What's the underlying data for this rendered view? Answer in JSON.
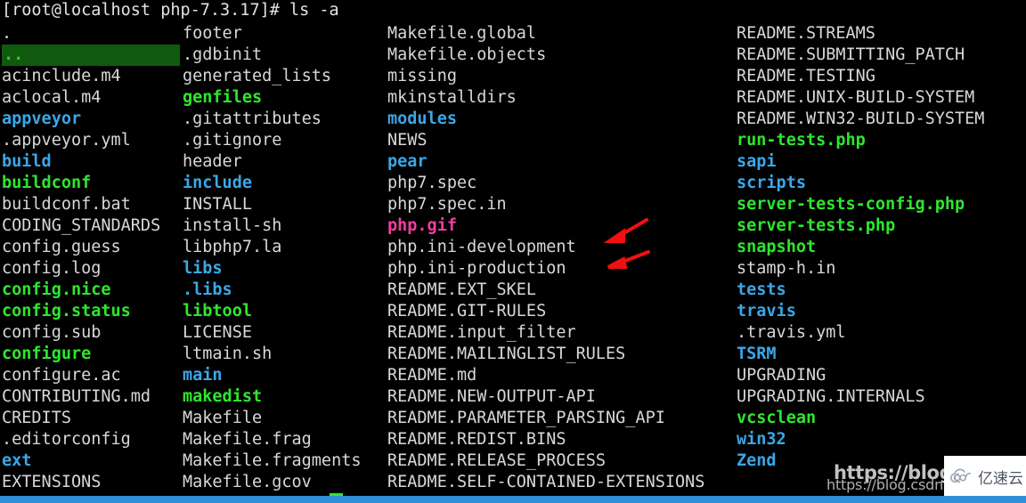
{
  "terminal": {
    "prompt": "[root@localhost php-7.3.17]# ls -a",
    "columns": [
      {
        "name": "column-1",
        "entries": [
          {
            "label": ".",
            "style": "c-white"
          },
          {
            "label": "..",
            "style": "c-selgreen"
          },
          {
            "label": "acinclude.m4",
            "style": "c-white"
          },
          {
            "label": "aclocal.m4",
            "style": "c-white"
          },
          {
            "label": "appveyor",
            "style": "c-blue"
          },
          {
            "label": ".appveyor.yml",
            "style": "c-white"
          },
          {
            "label": "build",
            "style": "c-blue"
          },
          {
            "label": "buildconf",
            "style": "c-green"
          },
          {
            "label": "buildconf.bat",
            "style": "c-white"
          },
          {
            "label": "CODING_STANDARDS",
            "style": "c-white"
          },
          {
            "label": "config.guess",
            "style": "c-white"
          },
          {
            "label": "config.log",
            "style": "c-white"
          },
          {
            "label": "config.nice",
            "style": "c-green"
          },
          {
            "label": "config.status",
            "style": "c-green"
          },
          {
            "label": "config.sub",
            "style": "c-white"
          },
          {
            "label": "configure",
            "style": "c-green"
          },
          {
            "label": "configure.ac",
            "style": "c-white"
          },
          {
            "label": "CONTRIBUTING.md",
            "style": "c-white"
          },
          {
            "label": "CREDITS",
            "style": "c-white"
          },
          {
            "label": ".editorconfig",
            "style": "c-white"
          },
          {
            "label": "ext",
            "style": "c-blue"
          },
          {
            "label": "EXTENSIONS",
            "style": "c-white"
          }
        ]
      },
      {
        "name": "column-2",
        "entries": [
          {
            "label": "footer",
            "style": "c-white"
          },
          {
            "label": ".gdbinit",
            "style": "c-white"
          },
          {
            "label": "generated_lists",
            "style": "c-white"
          },
          {
            "label": "genfiles",
            "style": "c-green"
          },
          {
            "label": ".gitattributes",
            "style": "c-white"
          },
          {
            "label": ".gitignore",
            "style": "c-white"
          },
          {
            "label": "header",
            "style": "c-white"
          },
          {
            "label": "include",
            "style": "c-blue"
          },
          {
            "label": "INSTALL",
            "style": "c-white"
          },
          {
            "label": "install-sh",
            "style": "c-white"
          },
          {
            "label": "libphp7.la",
            "style": "c-white"
          },
          {
            "label": "libs",
            "style": "c-blue"
          },
          {
            "label": ".libs",
            "style": "c-blue"
          },
          {
            "label": "libtool",
            "style": "c-green"
          },
          {
            "label": "LICENSE",
            "style": "c-white"
          },
          {
            "label": "ltmain.sh",
            "style": "c-white"
          },
          {
            "label": "main",
            "style": "c-blue"
          },
          {
            "label": "makedist",
            "style": "c-green"
          },
          {
            "label": "Makefile",
            "style": "c-white"
          },
          {
            "label": "Makefile.frag",
            "style": "c-white"
          },
          {
            "label": "Makefile.fragments",
            "style": "c-white"
          },
          {
            "label": "Makefile.gcov",
            "style": "c-white"
          }
        ]
      },
      {
        "name": "column-3",
        "entries": [
          {
            "label": "Makefile.global",
            "style": "c-white"
          },
          {
            "label": "Makefile.objects",
            "style": "c-white"
          },
          {
            "label": "missing",
            "style": "c-white"
          },
          {
            "label": "mkinstalldirs",
            "style": "c-white"
          },
          {
            "label": "modules",
            "style": "c-blue"
          },
          {
            "label": "NEWS",
            "style": "c-white"
          },
          {
            "label": "pear",
            "style": "c-blue"
          },
          {
            "label": "php7.spec",
            "style": "c-white"
          },
          {
            "label": "php7.spec.in",
            "style": "c-white"
          },
          {
            "label": "php.gif",
            "style": "c-pink"
          },
          {
            "label": "php.ini-development",
            "style": "c-white"
          },
          {
            "label": "php.ini-production",
            "style": "c-white"
          },
          {
            "label": "README.EXT_SKEL",
            "style": "c-white"
          },
          {
            "label": "README.GIT-RULES",
            "style": "c-white"
          },
          {
            "label": "README.input_filter",
            "style": "c-white"
          },
          {
            "label": "README.MAILINGLIST_RULES",
            "style": "c-white"
          },
          {
            "label": "README.md",
            "style": "c-white"
          },
          {
            "label": "README.NEW-OUTPUT-API",
            "style": "c-white"
          },
          {
            "label": "README.PARAMETER_PARSING_API",
            "style": "c-white"
          },
          {
            "label": "README.REDIST.BINS",
            "style": "c-white"
          },
          {
            "label": "README.RELEASE_PROCESS",
            "style": "c-white"
          },
          {
            "label": "README.SELF-CONTAINED-EXTENSIONS",
            "style": "c-white"
          }
        ]
      },
      {
        "name": "column-4",
        "entries": [
          {
            "label": "README.STREAMS",
            "style": "c-white"
          },
          {
            "label": "README.SUBMITTING_PATCH",
            "style": "c-white"
          },
          {
            "label": "README.TESTING",
            "style": "c-white"
          },
          {
            "label": "README.UNIX-BUILD-SYSTEM",
            "style": "c-white"
          },
          {
            "label": "README.WIN32-BUILD-SYSTEM",
            "style": "c-white"
          },
          {
            "label": "run-tests.php",
            "style": "c-green"
          },
          {
            "label": "sapi",
            "style": "c-blue"
          },
          {
            "label": "scripts",
            "style": "c-blue"
          },
          {
            "label": "server-tests-config.php",
            "style": "c-green"
          },
          {
            "label": "server-tests.php",
            "style": "c-green"
          },
          {
            "label": "snapshot",
            "style": "c-green"
          },
          {
            "label": "stamp-h.in",
            "style": "c-white"
          },
          {
            "label": "tests",
            "style": "c-blue"
          },
          {
            "label": "travis",
            "style": "c-blue"
          },
          {
            "label": ".travis.yml",
            "style": "c-white"
          },
          {
            "label": "TSRM",
            "style": "c-blue"
          },
          {
            "label": "UPGRADING",
            "style": "c-white"
          },
          {
            "label": "UPGRADING.INTERNALS",
            "style": "c-white"
          },
          {
            "label": "vcsclean",
            "style": "c-green"
          },
          {
            "label": "win32",
            "style": "c-blue"
          },
          {
            "label": "Zend",
            "style": "c-blue"
          }
        ]
      }
    ]
  },
  "annotations": {
    "arrow_color": "#f01010",
    "arrows": [
      {
        "name": "arrow-php-ini-development",
        "target": "php.ini-development"
      },
      {
        "name": "arrow-php-ini-production",
        "target": "php.ini-production"
      }
    ]
  },
  "watermark": {
    "big_text": "https://blog.c",
    "small_text": "https://blog.csdn",
    "logo_text": "亿速云"
  },
  "colors": {
    "background": "#000000",
    "text_white": "#d8d8d8",
    "dir_blue": "#3ba7e8",
    "exec_green": "#2ee62e",
    "image_pink": "#f03ea0",
    "bottom_bar": "#2f8fd8",
    "cursor": "#2ee62e"
  }
}
